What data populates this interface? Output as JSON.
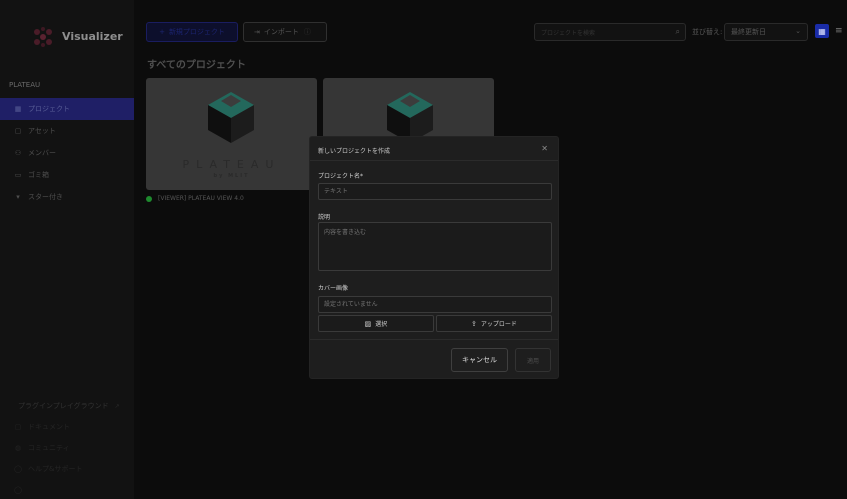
{
  "app": {
    "name": "Visualizer",
    "workspace": "PLATEAU"
  },
  "sidebar": {
    "items": [
      {
        "icon": "grid-icon",
        "label": "プロジェクト",
        "active": true
      },
      {
        "icon": "file-icon",
        "label": "アセット",
        "active": false
      },
      {
        "icon": "user-icon",
        "label": "メンバー",
        "active": false
      },
      {
        "icon": "trash-icon",
        "label": "ゴミ箱",
        "active": false
      },
      {
        "icon": "star-icon",
        "label": "スター付き",
        "active": false
      }
    ],
    "section2_title": "プラグインプレイグラウンド",
    "section2_items": [
      {
        "icon": "document-icon",
        "label": "ドキュメント"
      },
      {
        "icon": "community-icon",
        "label": "コミュニティ"
      },
      {
        "icon": "help-icon",
        "label": "ヘルプ&サポート"
      },
      {
        "icon": "terms-icon",
        "label": ""
      }
    ]
  },
  "topbar": {
    "new_project_label": "新規プロジェクト",
    "import_label": "インポート",
    "search_placeholder": "プロジェクトを検索",
    "sort_label": "並び替え:",
    "sort_value": "最終更新日"
  },
  "main": {
    "section_title": "すべてのプロジェクト",
    "projects": [
      {
        "name": "[VIEWER] PLATEAU VIEW 4.0",
        "logo_text": "PLATEAU",
        "logo_sub": "by MLIT",
        "status_color": "#1e8a2e"
      },
      {
        "name": "",
        "logo_text": "",
        "logo_sub": ""
      }
    ]
  },
  "modal": {
    "title": "新しいプロジェクトを作成",
    "name_label": "プロジェクト名",
    "required_mark": "*",
    "name_placeholder": "テキスト",
    "desc_label": "説明",
    "desc_placeholder": "内容を書き込む",
    "cover_label": "カバー画像",
    "cover_placeholder": "設定されていません",
    "select_label": "選択",
    "upload_label": "アップロード",
    "cancel_label": "キャンセル",
    "apply_label": "適用"
  },
  "colors": {
    "accent": "#1a2ca8",
    "active_nav": "#1f1f66",
    "logo_teal": "#23685c"
  }
}
